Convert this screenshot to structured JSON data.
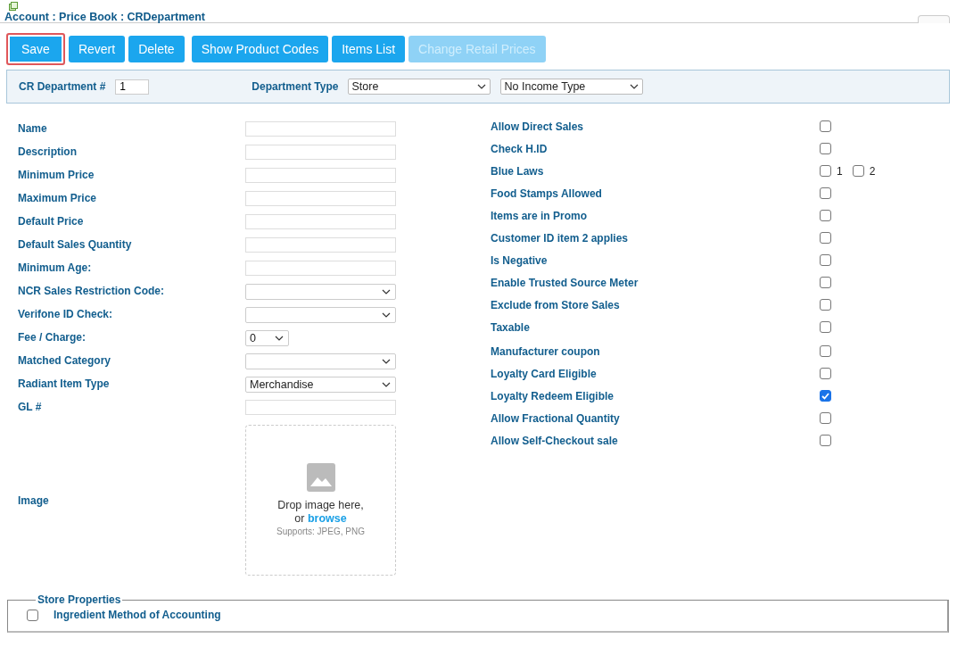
{
  "title": "Account : Price Book : CRDepartment",
  "buttons": [
    {
      "label": "Save",
      "highlighted": true,
      "disabled": false
    },
    {
      "label": "Revert",
      "highlighted": false,
      "disabled": false
    },
    {
      "label": "Delete",
      "highlighted": false,
      "disabled": false
    },
    {
      "label": "Show Product Codes",
      "highlighted": false,
      "disabled": false
    },
    {
      "label": "Items List",
      "highlighted": false,
      "disabled": false
    },
    {
      "label": "Change Retail Prices",
      "highlighted": false,
      "disabled": true
    }
  ],
  "department_bar": {
    "number_label": "CR Department #",
    "number_value": "1",
    "type_label": "Department Type",
    "type_value": "Store",
    "income_value": "No Income Type"
  },
  "left_fields": [
    {
      "kind": "text",
      "label": "Name"
    },
    {
      "kind": "text",
      "label": "Description"
    },
    {
      "kind": "text",
      "label": "Minimum Price"
    },
    {
      "kind": "text",
      "label": "Maximum Price"
    },
    {
      "kind": "text",
      "label": "Default Price"
    },
    {
      "kind": "text",
      "label": "Default Sales Quantity"
    },
    {
      "kind": "text",
      "label": "Minimum Age:"
    },
    {
      "kind": "select",
      "label": "NCR Sales Restriction Code:"
    },
    {
      "kind": "select",
      "label": "Verifone ID Check:"
    },
    {
      "kind": "small-select",
      "label": "Fee / Charge:",
      "value": "0"
    },
    {
      "kind": "select",
      "label": "Matched Category"
    },
    {
      "kind": "select",
      "label": "Radiant Item Type",
      "value": "Merchandise"
    },
    {
      "kind": "text",
      "label": "GL #"
    },
    {
      "kind": "image",
      "label": "Image",
      "drop_text": "Drop image here,",
      "or_text": "or",
      "browse_link": "browse",
      "supports": "Supports: JPEG, PNG"
    }
  ],
  "right_fields": [
    {
      "label": "Allow Direct Sales",
      "checked": false
    },
    {
      "label": "Check H.ID",
      "checked": false
    },
    {
      "label": "Blue Laws",
      "options": [
        {
          "label": "1",
          "checked": false
        },
        {
          "label": "2",
          "checked": false
        }
      ]
    },
    {
      "label": "Food Stamps Allowed",
      "checked": false
    },
    {
      "label": "Items are in Promo",
      "checked": false
    },
    {
      "label": "Customer ID item 2 applies",
      "checked": false
    },
    {
      "label": "Is Negative",
      "checked": false
    },
    {
      "label": "Enable Trusted Source Meter",
      "checked": false
    },
    {
      "label": "Exclude from Store Sales",
      "checked": false
    },
    {
      "label": "Taxable",
      "checked": false
    },
    {
      "label": "Manufacturer coupon",
      "checked": false
    },
    {
      "label": "Loyalty Card Eligible",
      "checked": false
    },
    {
      "label": "Loyalty Redeem Eligible",
      "checked": true
    },
    {
      "label": "Allow Fractional Quantity",
      "checked": false
    },
    {
      "label": "Allow Self-Checkout sale",
      "checked": false
    }
  ],
  "store_properties": {
    "legend": "Store Properties",
    "items": [
      {
        "label": "Ingredient Method of Accounting",
        "checked": false
      }
    ]
  }
}
